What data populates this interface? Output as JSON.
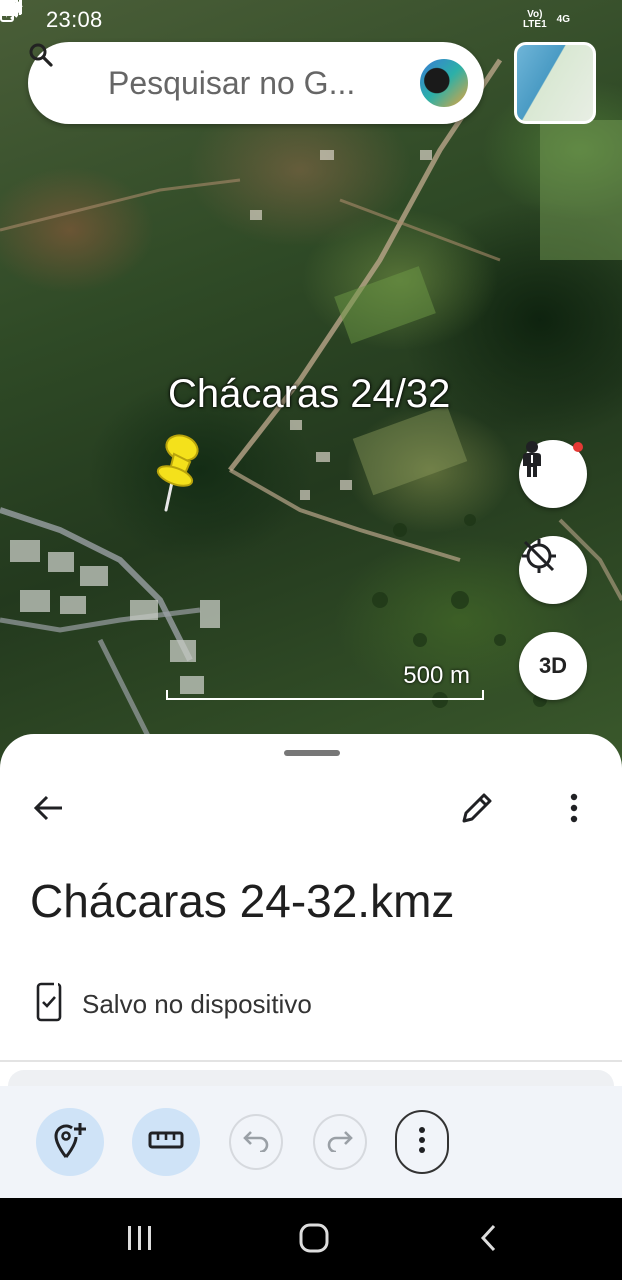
{
  "status_bar": {
    "time": "23:08",
    "network_top": "Vo)",
    "network_bottom": "LTE1",
    "network_type": "4G",
    "icons": [
      "image-icon",
      "cloud-icon",
      "gmail-icon",
      "dot-icon",
      "mute-icon",
      "wifi-icon",
      "signal-icon",
      "battery-icon"
    ]
  },
  "search": {
    "placeholder": "Pesquisar no G..."
  },
  "map": {
    "place_label": "Chácaras 24/32",
    "scale_label": "500 m",
    "three_d_label": "3D"
  },
  "sheet": {
    "title": "Chácaras 24-32.kmz",
    "saved_status": "Salvo no dispositivo"
  },
  "colors": {
    "accent_light": "#cfe3f7",
    "sheet_bg": "#ffffff",
    "action_bar_bg": "#f1f4f9",
    "pin_yellow": "#f4e11b"
  }
}
